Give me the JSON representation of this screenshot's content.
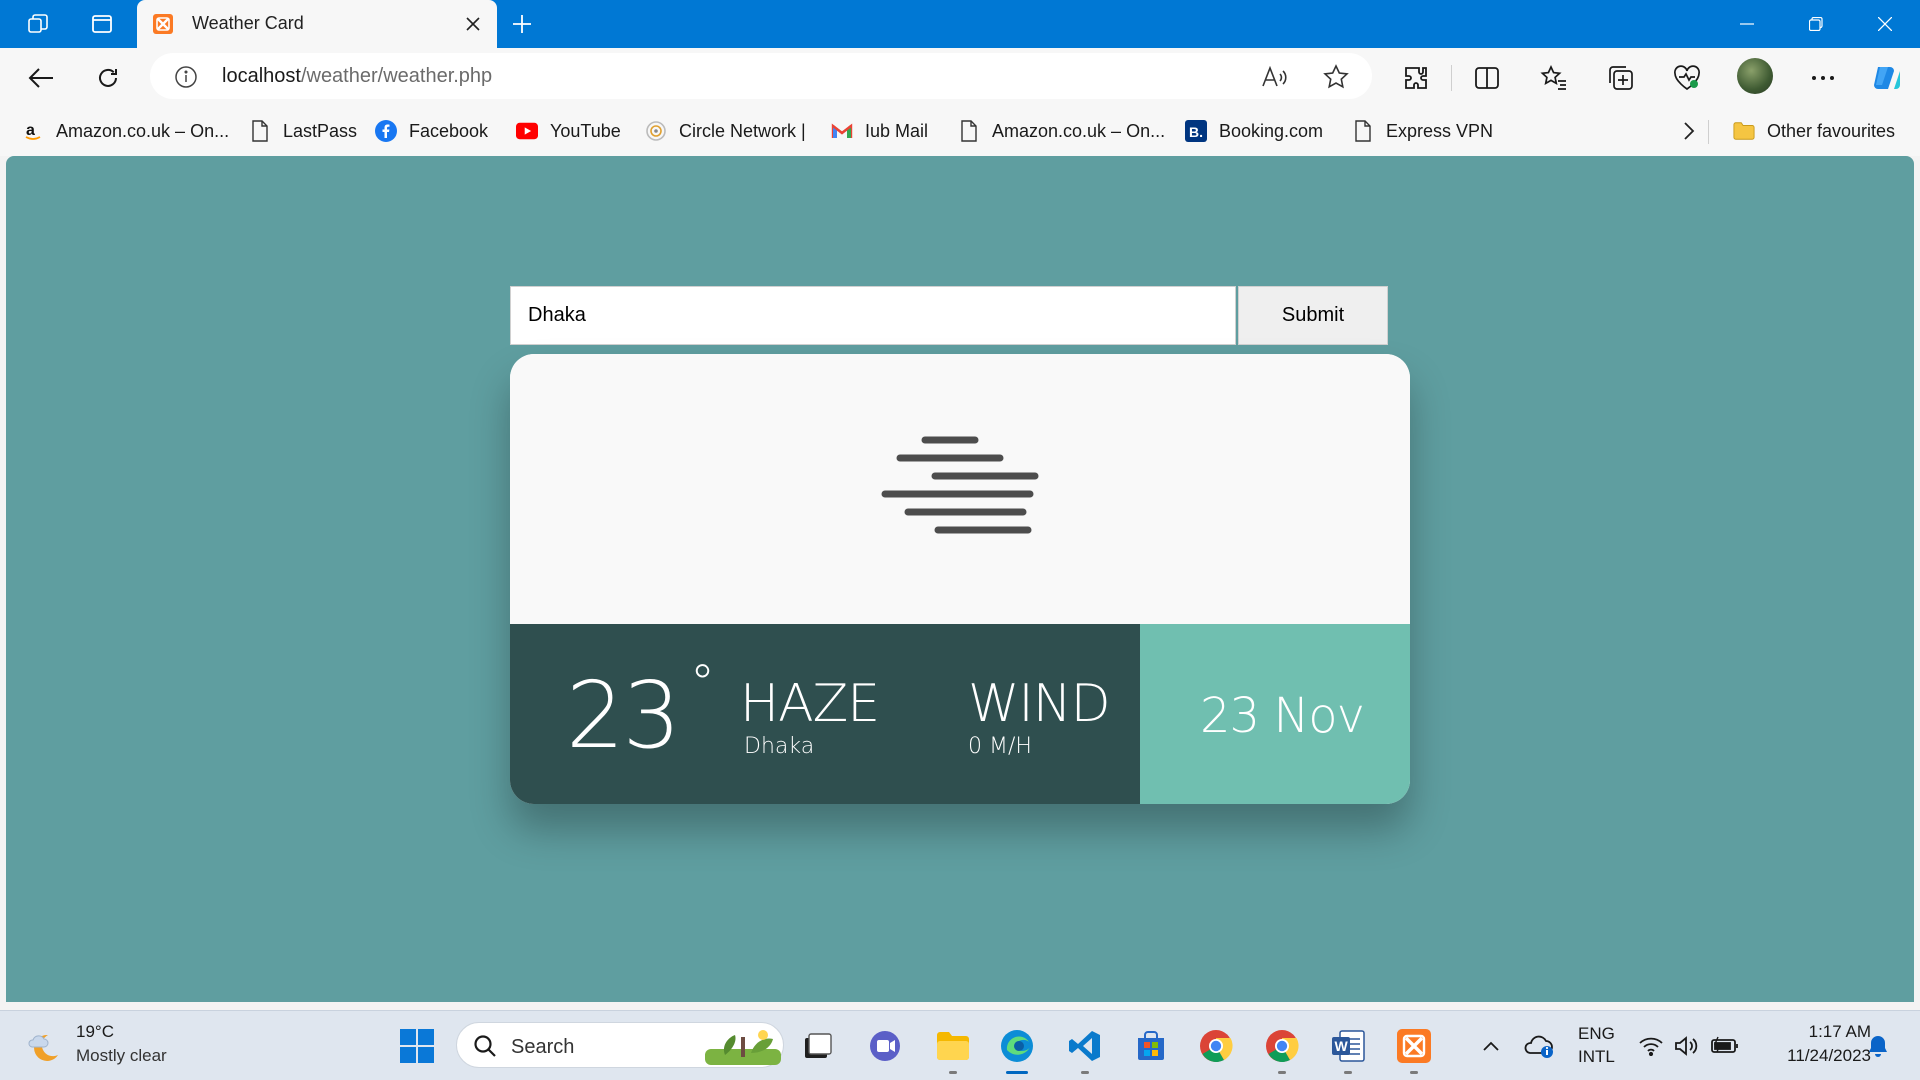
{
  "browser": {
    "tab_title": "Weather Card",
    "url_host": "localhost",
    "url_path": "/weather/weather.php",
    "favourites": [
      {
        "label": "Amazon.co.uk – On...",
        "icon": "amazon-icon"
      },
      {
        "label": "LastPass",
        "icon": "page-icon"
      },
      {
        "label": "Facebook",
        "icon": "facebook-icon"
      },
      {
        "label": "YouTube",
        "icon": "youtube-icon"
      },
      {
        "label": "Circle Network |",
        "icon": "circle-network-icon"
      },
      {
        "label": "Iub Mail",
        "icon": "gmail-icon"
      },
      {
        "label": "Amazon.co.uk – On...",
        "icon": "page-icon"
      },
      {
        "label": "Booking.com",
        "icon": "booking-icon"
      },
      {
        "label": "Express VPN",
        "icon": "page-icon"
      }
    ],
    "other_favourites": "Other favourites"
  },
  "page": {
    "search_value": "Dhaka",
    "submit_label": "Submit",
    "weather": {
      "temperature": "23",
      "degree_symbol": "°",
      "condition": "HAZE",
      "city": "Dhaka",
      "wind_label": "WIND",
      "wind_value": "0 M/H",
      "date": "23 Nov"
    },
    "colors": {
      "page_bg": "#5f9ea0",
      "card_dark": "#2f4f4f",
      "card_accent": "#70bfb0"
    }
  },
  "taskbar": {
    "weather_temp": "19°C",
    "weather_desc": "Mostly clear",
    "search_label": "Search",
    "lang_top": "ENG",
    "lang_bottom": "INTL",
    "time": "1:17 AM",
    "date": "11/24/2023"
  }
}
